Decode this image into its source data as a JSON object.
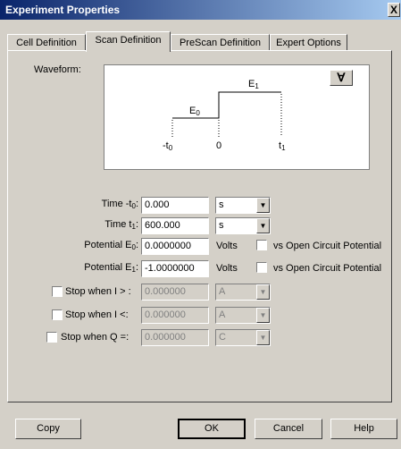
{
  "window": {
    "title": "Experiment Properties",
    "close_symbol": "X"
  },
  "tabs": [
    {
      "label": "Cell Definition",
      "active": false
    },
    {
      "label": "Scan Definition",
      "active": true
    },
    {
      "label": "PreScan Definition",
      "active": false
    },
    {
      "label": "Expert Options",
      "active": false
    }
  ],
  "waveform": {
    "label": "Waveform:",
    "toggle_symbol": "∀",
    "e0_main": "E",
    "e0_sub": "0",
    "e1_main": "E",
    "e1_sub": "1",
    "t0_main": "-t",
    "t0_sub": "0",
    "zero": "0",
    "t1_main": "t",
    "t1_sub": "1"
  },
  "params": {
    "time_t0": {
      "label_main": "Time -t",
      "label_sub": "0",
      "value": "0.000",
      "unit": "s"
    },
    "time_t1": {
      "label_main": "Time t",
      "label_sub": "1",
      "value": "600.000",
      "unit": "s"
    },
    "potential_e0": {
      "label_main": "Potential E",
      "label_sub": "0",
      "value": "0.0000000",
      "unit": "Volts",
      "vs_label": "vs Open Circuit Potential"
    },
    "potential_e1": {
      "label_main": "Potential E",
      "label_sub": "1",
      "value": "-1.0000000",
      "unit": "Volts",
      "vs_label": "vs Open Circuit Potential"
    }
  },
  "stops": [
    {
      "label": "Stop when I > :",
      "value": "0.000000",
      "unit": "A"
    },
    {
      "label": "Stop when I <:",
      "value": "0.000000",
      "unit": "A"
    },
    {
      "label": "Stop when Q =:",
      "value": "0.000000",
      "unit": "C"
    }
  ],
  "buttons": {
    "copy": "Copy",
    "ok": "OK",
    "cancel": "Cancel",
    "help": "Help"
  }
}
